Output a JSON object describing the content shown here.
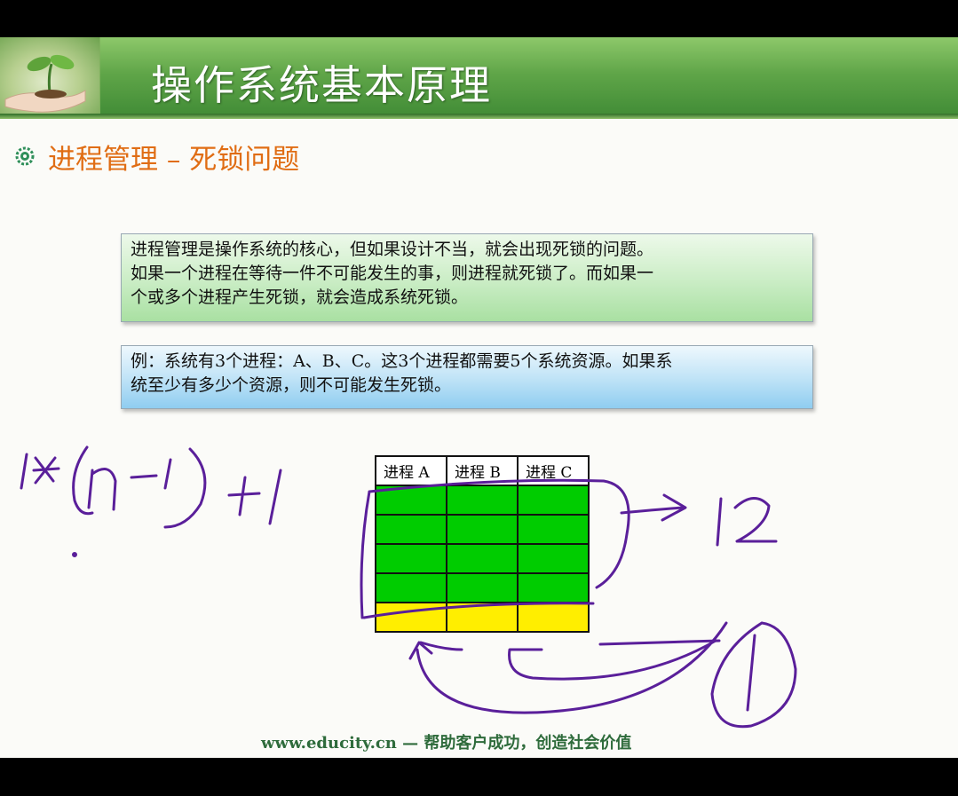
{
  "header": {
    "title": "操作系统基本原理"
  },
  "section": {
    "title": "进程管理 – 死锁问题",
    "bullet_icon": "gear-icon"
  },
  "intro_box": {
    "line1": "进程管理是操作系统的核心，但如果设计不当，就会出现死锁的问题。",
    "line2": "如果一个进程在等待一件不可能发生的事，则进程就死锁了。而如果一",
    "line3": "个或多个进程产生死锁，就会造成系统死锁。"
  },
  "example_box": {
    "line1": "例：系统有3个进程：A、B、C。这3个进程都需要5个系统资源。如果系",
    "line2": "统至少有多少个资源，则不可能发生死锁。"
  },
  "resource_table": {
    "headers": [
      "进程 A",
      "进程 B",
      "进程 C"
    ],
    "green_rows": 4,
    "yellow_rows": 1,
    "colors": {
      "allocated": "#00cc00",
      "extra": "#ffee00"
    }
  },
  "footer": {
    "text": "www.educity.cn — 帮助客户成功，创造社会价值"
  },
  "colors": {
    "banner_green": "#5fa548",
    "section_orange": "#e06d14",
    "footer_green": "#2e6b3b",
    "ink": "#5a1f9a"
  }
}
